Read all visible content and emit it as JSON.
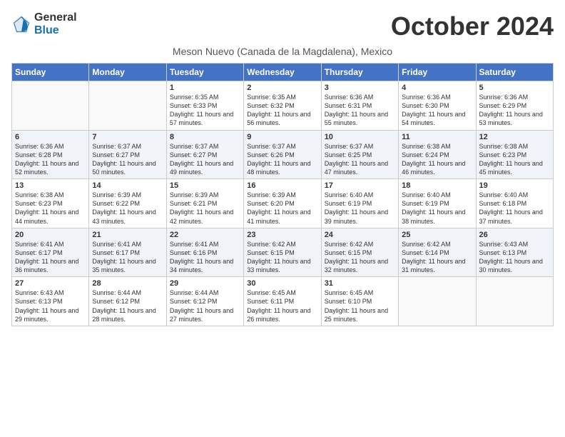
{
  "logo": {
    "general": "General",
    "blue": "Blue"
  },
  "title": "October 2024",
  "subtitle": "Meson Nuevo (Canada de la Magdalena), Mexico",
  "days_of_week": [
    "Sunday",
    "Monday",
    "Tuesday",
    "Wednesday",
    "Thursday",
    "Friday",
    "Saturday"
  ],
  "weeks": [
    [
      {
        "day": "",
        "sunrise": "",
        "sunset": "",
        "daylight": ""
      },
      {
        "day": "",
        "sunrise": "",
        "sunset": "",
        "daylight": ""
      },
      {
        "day": "1",
        "sunrise": "Sunrise: 6:35 AM",
        "sunset": "Sunset: 6:33 PM",
        "daylight": "Daylight: 11 hours and 57 minutes."
      },
      {
        "day": "2",
        "sunrise": "Sunrise: 6:35 AM",
        "sunset": "Sunset: 6:32 PM",
        "daylight": "Daylight: 11 hours and 56 minutes."
      },
      {
        "day": "3",
        "sunrise": "Sunrise: 6:36 AM",
        "sunset": "Sunset: 6:31 PM",
        "daylight": "Daylight: 11 hours and 55 minutes."
      },
      {
        "day": "4",
        "sunrise": "Sunrise: 6:36 AM",
        "sunset": "Sunset: 6:30 PM",
        "daylight": "Daylight: 11 hours and 54 minutes."
      },
      {
        "day": "5",
        "sunrise": "Sunrise: 6:36 AM",
        "sunset": "Sunset: 6:29 PM",
        "daylight": "Daylight: 11 hours and 53 minutes."
      }
    ],
    [
      {
        "day": "6",
        "sunrise": "Sunrise: 6:36 AM",
        "sunset": "Sunset: 6:28 PM",
        "daylight": "Daylight: 11 hours and 52 minutes."
      },
      {
        "day": "7",
        "sunrise": "Sunrise: 6:37 AM",
        "sunset": "Sunset: 6:27 PM",
        "daylight": "Daylight: 11 hours and 50 minutes."
      },
      {
        "day": "8",
        "sunrise": "Sunrise: 6:37 AM",
        "sunset": "Sunset: 6:27 PM",
        "daylight": "Daylight: 11 hours and 49 minutes."
      },
      {
        "day": "9",
        "sunrise": "Sunrise: 6:37 AM",
        "sunset": "Sunset: 6:26 PM",
        "daylight": "Daylight: 11 hours and 48 minutes."
      },
      {
        "day": "10",
        "sunrise": "Sunrise: 6:37 AM",
        "sunset": "Sunset: 6:25 PM",
        "daylight": "Daylight: 11 hours and 47 minutes."
      },
      {
        "day": "11",
        "sunrise": "Sunrise: 6:38 AM",
        "sunset": "Sunset: 6:24 PM",
        "daylight": "Daylight: 11 hours and 46 minutes."
      },
      {
        "day": "12",
        "sunrise": "Sunrise: 6:38 AM",
        "sunset": "Sunset: 6:23 PM",
        "daylight": "Daylight: 11 hours and 45 minutes."
      }
    ],
    [
      {
        "day": "13",
        "sunrise": "Sunrise: 6:38 AM",
        "sunset": "Sunset: 6:23 PM",
        "daylight": "Daylight: 11 hours and 44 minutes."
      },
      {
        "day": "14",
        "sunrise": "Sunrise: 6:39 AM",
        "sunset": "Sunset: 6:22 PM",
        "daylight": "Daylight: 11 hours and 43 minutes."
      },
      {
        "day": "15",
        "sunrise": "Sunrise: 6:39 AM",
        "sunset": "Sunset: 6:21 PM",
        "daylight": "Daylight: 11 hours and 42 minutes."
      },
      {
        "day": "16",
        "sunrise": "Sunrise: 6:39 AM",
        "sunset": "Sunset: 6:20 PM",
        "daylight": "Daylight: 11 hours and 41 minutes."
      },
      {
        "day": "17",
        "sunrise": "Sunrise: 6:40 AM",
        "sunset": "Sunset: 6:19 PM",
        "daylight": "Daylight: 11 hours and 39 minutes."
      },
      {
        "day": "18",
        "sunrise": "Sunrise: 6:40 AM",
        "sunset": "Sunset: 6:19 PM",
        "daylight": "Daylight: 11 hours and 38 minutes."
      },
      {
        "day": "19",
        "sunrise": "Sunrise: 6:40 AM",
        "sunset": "Sunset: 6:18 PM",
        "daylight": "Daylight: 11 hours and 37 minutes."
      }
    ],
    [
      {
        "day": "20",
        "sunrise": "Sunrise: 6:41 AM",
        "sunset": "Sunset: 6:17 PM",
        "daylight": "Daylight: 11 hours and 36 minutes."
      },
      {
        "day": "21",
        "sunrise": "Sunrise: 6:41 AM",
        "sunset": "Sunset: 6:17 PM",
        "daylight": "Daylight: 11 hours and 35 minutes."
      },
      {
        "day": "22",
        "sunrise": "Sunrise: 6:41 AM",
        "sunset": "Sunset: 6:16 PM",
        "daylight": "Daylight: 11 hours and 34 minutes."
      },
      {
        "day": "23",
        "sunrise": "Sunrise: 6:42 AM",
        "sunset": "Sunset: 6:15 PM",
        "daylight": "Daylight: 11 hours and 33 minutes."
      },
      {
        "day": "24",
        "sunrise": "Sunrise: 6:42 AM",
        "sunset": "Sunset: 6:15 PM",
        "daylight": "Daylight: 11 hours and 32 minutes."
      },
      {
        "day": "25",
        "sunrise": "Sunrise: 6:42 AM",
        "sunset": "Sunset: 6:14 PM",
        "daylight": "Daylight: 11 hours and 31 minutes."
      },
      {
        "day": "26",
        "sunrise": "Sunrise: 6:43 AM",
        "sunset": "Sunset: 6:13 PM",
        "daylight": "Daylight: 11 hours and 30 minutes."
      }
    ],
    [
      {
        "day": "27",
        "sunrise": "Sunrise: 6:43 AM",
        "sunset": "Sunset: 6:13 PM",
        "daylight": "Daylight: 11 hours and 29 minutes."
      },
      {
        "day": "28",
        "sunrise": "Sunrise: 6:44 AM",
        "sunset": "Sunset: 6:12 PM",
        "daylight": "Daylight: 11 hours and 28 minutes."
      },
      {
        "day": "29",
        "sunrise": "Sunrise: 6:44 AM",
        "sunset": "Sunset: 6:12 PM",
        "daylight": "Daylight: 11 hours and 27 minutes."
      },
      {
        "day": "30",
        "sunrise": "Sunrise: 6:45 AM",
        "sunset": "Sunset: 6:11 PM",
        "daylight": "Daylight: 11 hours and 26 minutes."
      },
      {
        "day": "31",
        "sunrise": "Sunrise: 6:45 AM",
        "sunset": "Sunset: 6:10 PM",
        "daylight": "Daylight: 11 hours and 25 minutes."
      },
      {
        "day": "",
        "sunrise": "",
        "sunset": "",
        "daylight": ""
      },
      {
        "day": "",
        "sunrise": "",
        "sunset": "",
        "daylight": ""
      }
    ]
  ]
}
